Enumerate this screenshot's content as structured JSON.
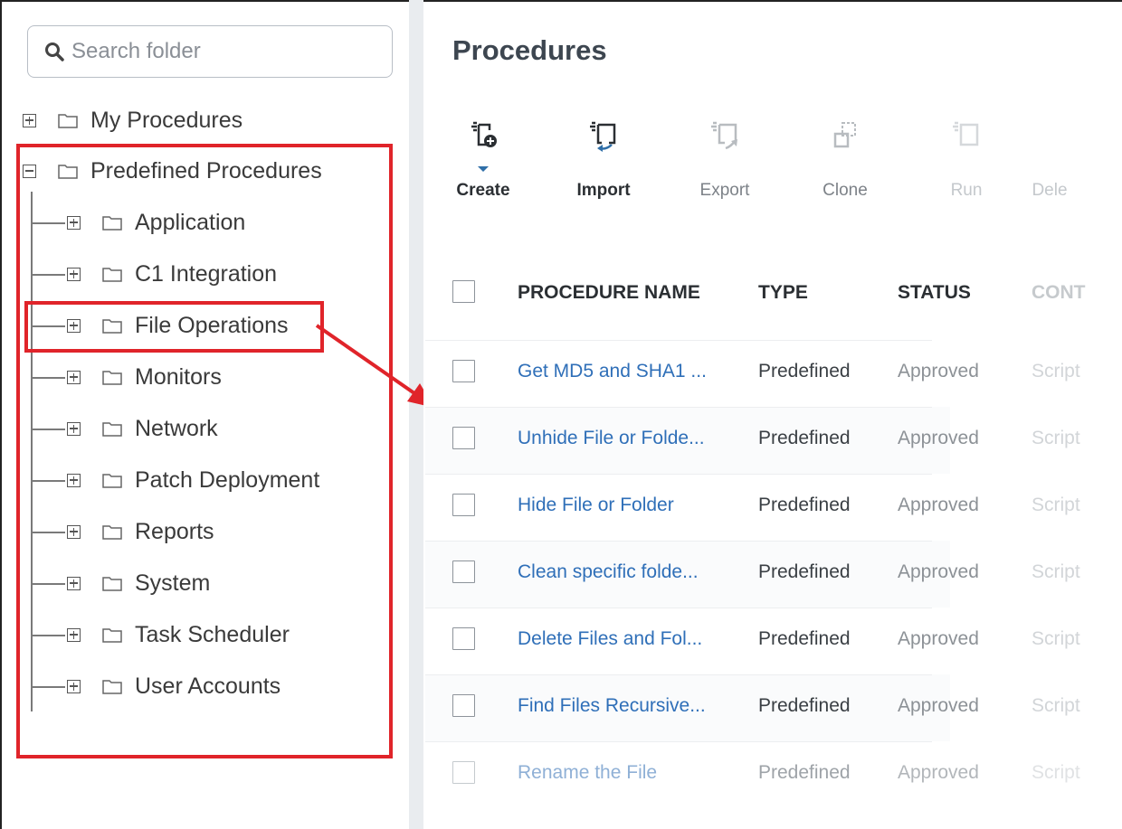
{
  "search": {
    "placeholder": "Search folder"
  },
  "tree": {
    "roots": [
      {
        "label": "My Procedures",
        "expanded": false
      },
      {
        "label": "Predefined Procedures",
        "expanded": true
      }
    ],
    "children": [
      "Application",
      "C1 Integration",
      "File Operations",
      "Monitors",
      "Network",
      "Patch Deployment",
      "Reports",
      "System",
      "Task Scheduler",
      "User Accounts"
    ],
    "highlighted": "File Operations"
  },
  "page": {
    "title": "Procedures"
  },
  "toolbar": {
    "create": "Create",
    "import": "Import",
    "export": "Export",
    "clone": "Clone",
    "run": "Run",
    "delete": "Dele"
  },
  "table": {
    "headers": {
      "name": "PROCEDURE NAME",
      "type": "TYPE",
      "status": "STATUS",
      "content": "CONT"
    },
    "rows": [
      {
        "name": "Get MD5 and SHA1 ...",
        "type": "Predefined",
        "status": "Approved",
        "content": "Script"
      },
      {
        "name": "Unhide File or Folde...",
        "type": "Predefined",
        "status": "Approved",
        "content": "Script"
      },
      {
        "name": "Hide File or Folder",
        "type": "Predefined",
        "status": "Approved",
        "content": "Script"
      },
      {
        "name": "Clean specific folde...",
        "type": "Predefined",
        "status": "Approved",
        "content": "Script"
      },
      {
        "name": "Delete Files and Fol...",
        "type": "Predefined",
        "status": "Approved",
        "content": "Script"
      },
      {
        "name": "Find Files Recursive...",
        "type": "Predefined",
        "status": "Approved",
        "content": "Script"
      },
      {
        "name": "Rename the File",
        "type": "Predefined",
        "status": "Approved",
        "content": "Script"
      }
    ]
  },
  "colors": {
    "highlight": "#e0242a",
    "link": "#2f6fb8",
    "title": "#3d4650"
  }
}
